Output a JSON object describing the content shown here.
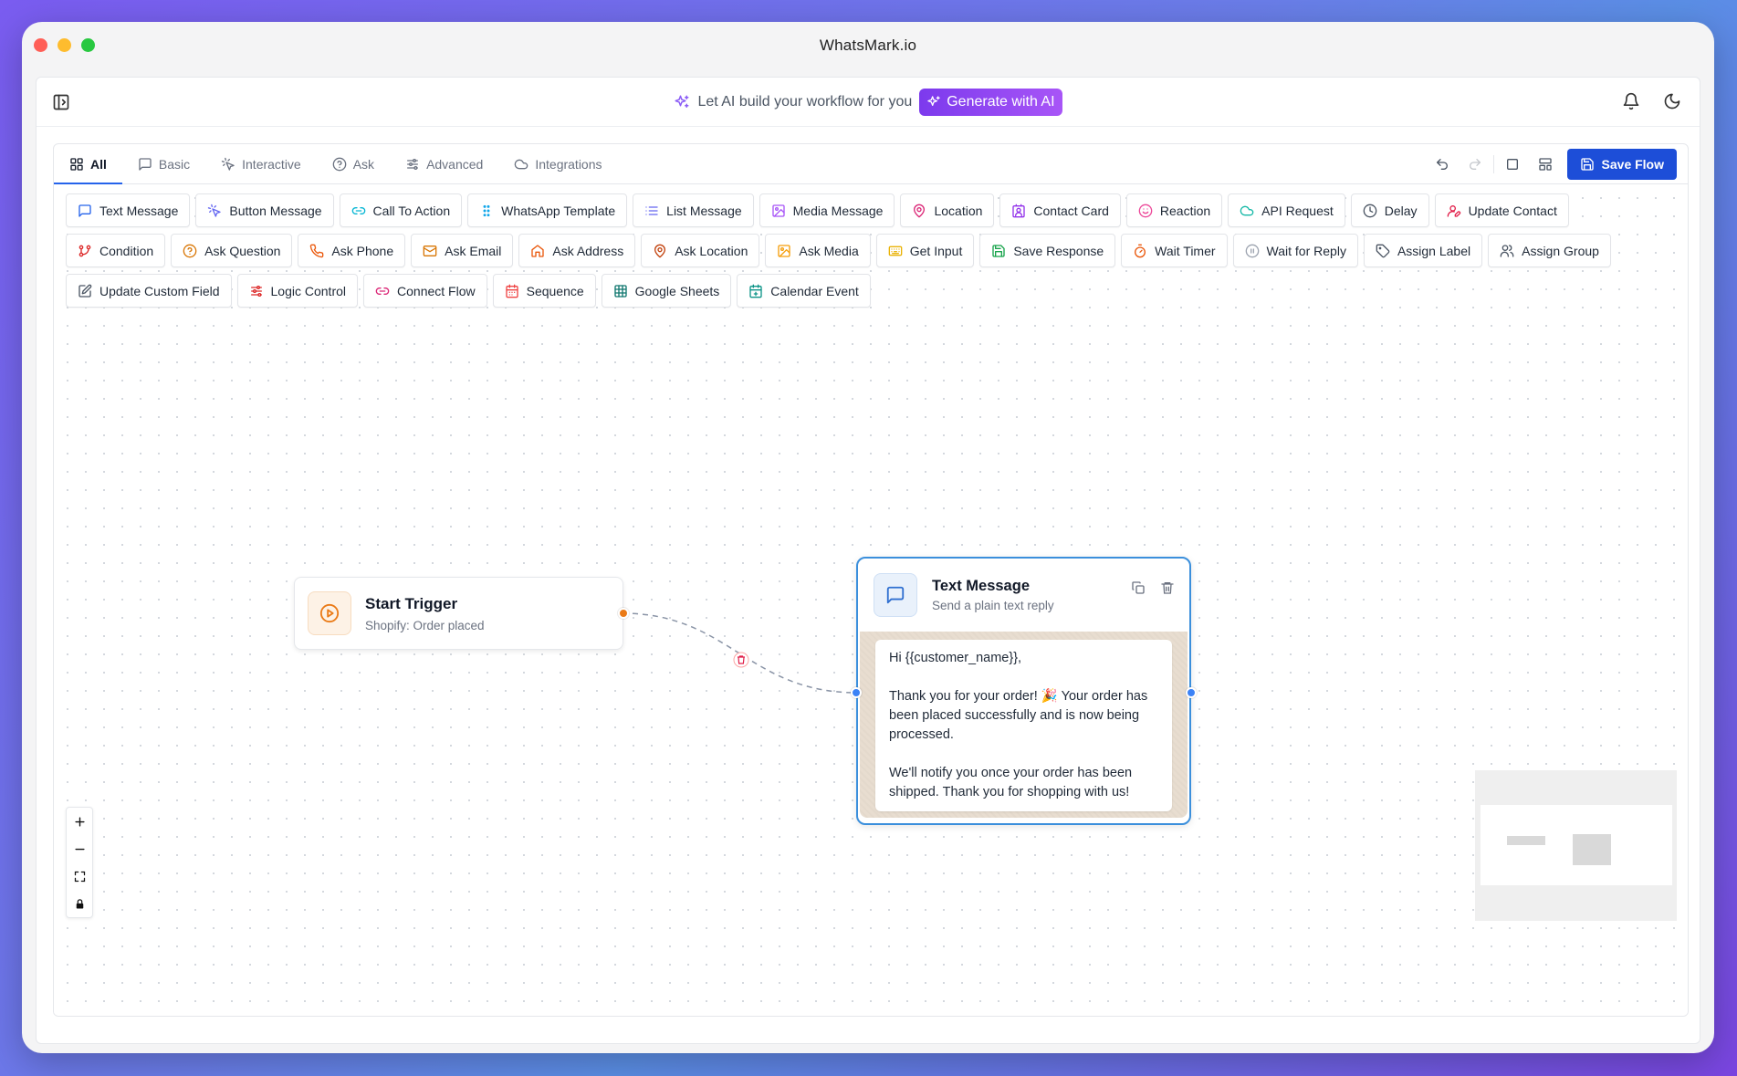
{
  "window": {
    "title": "WhatsMark.io"
  },
  "topbar": {
    "ai_prompt": "Let AI build your workflow for you",
    "generate_label": "Generate with AI"
  },
  "tabs": [
    {
      "label": "All",
      "icon": "grid-icon",
      "active": true
    },
    {
      "label": "Basic",
      "icon": "message-square-icon"
    },
    {
      "label": "Interactive",
      "icon": "pointer-click-icon"
    },
    {
      "label": "Ask",
      "icon": "help-circle-icon"
    },
    {
      "label": "Advanced",
      "icon": "sliders-icon"
    },
    {
      "label": "Integrations",
      "icon": "cloud-icon"
    }
  ],
  "toolbar": {
    "save_label": "Save Flow"
  },
  "palette": [
    {
      "label": "Text Message",
      "icon": "message-square-icon",
      "color": "#2563eb"
    },
    {
      "label": "Button Message",
      "icon": "pointer-click-icon",
      "color": "#6366f1"
    },
    {
      "label": "Call To Action",
      "icon": "link-icon",
      "color": "#06b6d4"
    },
    {
      "label": "WhatsApp Template",
      "icon": "grip-icon",
      "color": "#0ea5e9"
    },
    {
      "label": "List Message",
      "icon": "list-icon",
      "color": "#6366f1"
    },
    {
      "label": "Media Message",
      "icon": "image-icon",
      "color": "#a855f7"
    },
    {
      "label": "Location",
      "icon": "map-pin-icon",
      "color": "#db2777"
    },
    {
      "label": "Contact Card",
      "icon": "contact-icon",
      "color": "#9333ea"
    },
    {
      "label": "Reaction",
      "icon": "smile-icon",
      "color": "#ec4899"
    },
    {
      "label": "API Request",
      "icon": "cloud-icon",
      "color": "#14b8a6"
    },
    {
      "label": "Delay",
      "icon": "clock-icon",
      "color": "#4b5563"
    },
    {
      "label": "Update Contact",
      "icon": "user-pen-icon",
      "color": "#e11d48"
    },
    {
      "label": "Condition",
      "icon": "git-branch-icon",
      "color": "#dc2626"
    },
    {
      "label": "Ask Question",
      "icon": "help-circle-icon",
      "color": "#d97706"
    },
    {
      "label": "Ask Phone",
      "icon": "phone-icon",
      "color": "#ea580c"
    },
    {
      "label": "Ask Email",
      "icon": "mail-icon",
      "color": "#d97706"
    },
    {
      "label": "Ask Address",
      "icon": "home-icon",
      "color": "#ea580c"
    },
    {
      "label": "Ask Location",
      "icon": "map-pin-icon",
      "color": "#c2410c"
    },
    {
      "label": "Ask Media",
      "icon": "image-icon",
      "color": "#f59e0b"
    },
    {
      "label": "Get Input",
      "icon": "keyboard-icon",
      "color": "#eab308"
    },
    {
      "label": "Save Response",
      "icon": "save-icon",
      "color": "#16a34a"
    },
    {
      "label": "Wait Timer",
      "icon": "timer-icon",
      "color": "#ea580c"
    },
    {
      "label": "Wait for Reply",
      "icon": "pause-circle-icon",
      "color": "#9ca3af"
    },
    {
      "label": "Assign Label",
      "icon": "tag-icon",
      "color": "#4b5563"
    },
    {
      "label": "Assign Group",
      "icon": "users-icon",
      "color": "#4b5563"
    },
    {
      "label": "Update Custom Field",
      "icon": "edit-icon",
      "color": "#4b5563"
    },
    {
      "label": "Logic Control",
      "icon": "sliders-icon",
      "color": "#dc2626"
    },
    {
      "label": "Connect Flow",
      "icon": "link-icon",
      "color": "#db2777"
    },
    {
      "label": "Sequence",
      "icon": "calendar-icon",
      "color": "#ef4444"
    },
    {
      "label": "Google Sheets",
      "icon": "table-icon",
      "color": "#0f766e"
    },
    {
      "label": "Calendar Event",
      "icon": "calendar-plus-icon",
      "color": "#0d9488"
    }
  ],
  "nodes": {
    "start": {
      "title": "Start Trigger",
      "subtitle": "Shopify: Order placed",
      "color": "#ea7a16"
    },
    "text": {
      "title": "Text Message",
      "subtitle": "Send a plain text reply",
      "message": "Hi {{customer_name}},\n\nThank you for your order! 🎉 Your order has been placed successfully and is now being processed.\n\nWe'll notify you once your order has been shipped. Thank you for shopping with us!",
      "color": "#3b8fdc"
    }
  },
  "colors": {
    "accent": "#1d4ed8",
    "ai_gradient_start": "#7c3aed",
    "ai_gradient_end": "#a855f7"
  }
}
